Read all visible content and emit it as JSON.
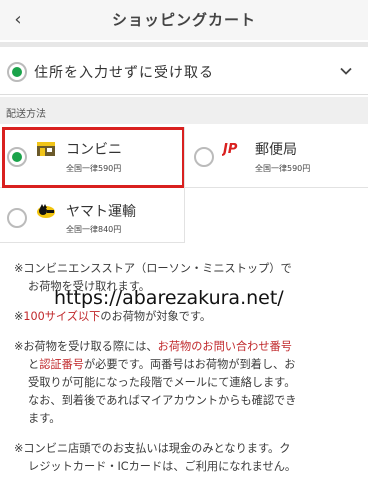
{
  "header": {
    "title": "ショッピングカート",
    "back_icon": "‹"
  },
  "receive": {
    "label": "住所を入力せずに受け取る"
  },
  "section": {
    "title": "配送方法"
  },
  "options": [
    {
      "name": "コンビニ",
      "price": "全国一律590円",
      "selected": true,
      "icon": "store-icon"
    },
    {
      "name": "郵便局",
      "price": "全国一律590円",
      "selected": false,
      "icon": "japan-post-icon"
    },
    {
      "name": "ヤマト運輸",
      "price": "全国一律840円",
      "selected": false,
      "icon": "yamato-cat-icon"
    }
  ],
  "notes": {
    "n1_l1": "※コンビニエンスストア（ローソン・ミニストップ）で",
    "n1_l2": "お荷物を受け取れます。",
    "n2_red": "100サイズ以下",
    "n2_pre": "※",
    "n2_post": "のお荷物が対象です。",
    "n3_l1_pre": "※お荷物を受け取る際には、",
    "n3_l1_red": "お荷物のお問い合わせ番号",
    "n3_l2_pre": "と",
    "n3_l2_red": "認証番号",
    "n3_l2_post": "が必要です。両番号はお荷物が到着し、お",
    "n3_l3": "受取りが可能になった段階でメールにて連絡します。",
    "n3_l4": "なお、到着後であればマイアカウントからも確認でき",
    "n3_l5": "ます。",
    "n4_l1": "※コンビニ店頭でのお支払いは現金のみとなります。ク",
    "n4_l2": "レジットカード・ICカードは、ご利用になれません。"
  },
  "watermark": "https://abarezakura.net/",
  "colors": {
    "accent_green": "#1aa34a",
    "highlight_red": "#d9201f",
    "note_red": "#c0282b"
  }
}
